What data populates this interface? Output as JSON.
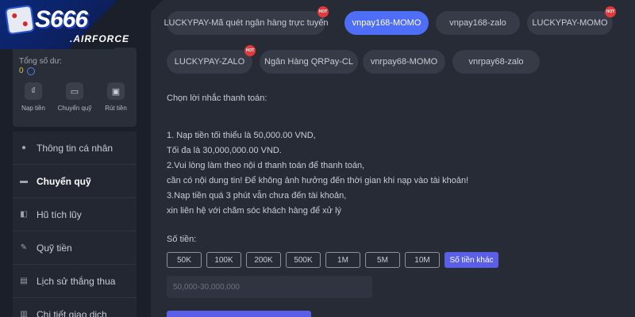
{
  "logo": {
    "main": "S666",
    "sub": ".AIRFORCE"
  },
  "sidebar": {
    "balance_label": "Tổng số dư:",
    "balance_value": "0",
    "quick_actions": [
      {
        "label": "Nạp tiền",
        "icon": "deposit-icon"
      },
      {
        "label": "Chuyển quỹ",
        "icon": "wallet-icon"
      },
      {
        "label": "Rút tiền",
        "icon": "withdraw-icon"
      }
    ],
    "menu": [
      {
        "label": "Thông tin cá nhân",
        "icon": "user-icon"
      },
      {
        "label": "Chuyển quỹ",
        "icon": "wallet-icon"
      },
      {
        "label": "Hũ tích lũy",
        "icon": "savings-icon"
      },
      {
        "label": "Quỹ tiền",
        "icon": "fund-icon"
      },
      {
        "label": "Lịch sử thắng thua",
        "icon": "history-icon"
      },
      {
        "label": "Chi tiết giao dịch",
        "icon": "transactions-icon"
      }
    ]
  },
  "payments": [
    {
      "label": "LUCKYPAY-Mã quét ngân hàng trực tuyến",
      "hot": true
    },
    {
      "label": "vnpay168-MOMO",
      "hot": false
    },
    {
      "label": "vnpay168-zalo",
      "hot": false
    },
    {
      "label": "LUCKYPAY-MOMO",
      "hot": true
    },
    {
      "label": "LUCKYPAY-ZALO",
      "hot": true
    },
    {
      "label": "Ngân Hàng QRPay-CL",
      "hot": false
    },
    {
      "label": "vnrpay68-MOMO",
      "hot": false
    },
    {
      "label": "vnrpay68-zalo",
      "hot": false
    }
  ],
  "hot_label": "HOT",
  "reminder_title": "Chọn lời nhắc thanh toán:",
  "notes": [
    "1. Nạp tiền tối thiểu là 50,000.00 VND,",
    "Tối đa là 30,000,000.00 VND.",
    "2.Vui lòng làm theo nội d thanh toán để thanh toán,",
    "cần có nội dung tin! Để không ảnh hưởng đến thời gian khi nạp  vào tài khoản!",
    "3.Nạp tiền quá 3 phút vẫn chưa đến tài khoản,",
    "xin liên hệ với chăm sóc khách hàng để xử lý"
  ],
  "amount": {
    "label": "Số tiền:",
    "options": [
      "50K",
      "100K",
      "200K",
      "500K",
      "1M",
      "5M",
      "10M",
      "Số tiền khác"
    ],
    "placeholder": "50,000-30,000,000"
  },
  "colors": {
    "accent": "#4f6ef7",
    "selected": "#5b5fe8",
    "hot": "#e23a3a",
    "balance": "#e6c34a"
  }
}
